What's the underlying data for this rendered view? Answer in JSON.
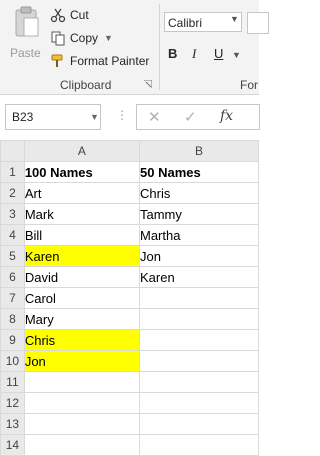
{
  "ribbon": {
    "paste_label": "Paste",
    "cut_label": "Cut",
    "copy_label": "Copy",
    "format_painter_label": "Format Painter",
    "clipboard_group_label": "Clipboard",
    "font_name": "Calibri",
    "bold_label": "B",
    "italic_label": "I",
    "underline_label": "U",
    "font_group_label": "For"
  },
  "formula_bar": {
    "name_box": "B23",
    "fx_label": "fx",
    "cancel_symbol": "✕",
    "enter_symbol": "✓"
  },
  "sheet": {
    "columns": [
      "A",
      "B"
    ],
    "selected_column": "B",
    "highlight_color": "#ffff00",
    "rows": [
      {
        "num": "1",
        "a": "100 Names",
        "b": "50 Names",
        "header": true
      },
      {
        "num": "2",
        "a": "Art",
        "b": "Chris"
      },
      {
        "num": "3",
        "a": "Mark",
        "b": "Tammy"
      },
      {
        "num": "4",
        "a": "Bill",
        "b": "Martha"
      },
      {
        "num": "5",
        "a": "Karen",
        "b": "Jon",
        "highlight_a": true
      },
      {
        "num": "6",
        "a": "David",
        "b": "Karen"
      },
      {
        "num": "7",
        "a": "Carol",
        "b": ""
      },
      {
        "num": "8",
        "a": "Mary",
        "b": ""
      },
      {
        "num": "9",
        "a": "Chris",
        "b": "",
        "highlight_a": true
      },
      {
        "num": "10",
        "a": "Jon",
        "b": "",
        "highlight_a": true
      },
      {
        "num": "11",
        "a": "",
        "b": ""
      },
      {
        "num": "12",
        "a": "",
        "b": ""
      },
      {
        "num": "13",
        "a": "",
        "b": ""
      },
      {
        "num": "14",
        "a": "",
        "b": ""
      }
    ]
  }
}
